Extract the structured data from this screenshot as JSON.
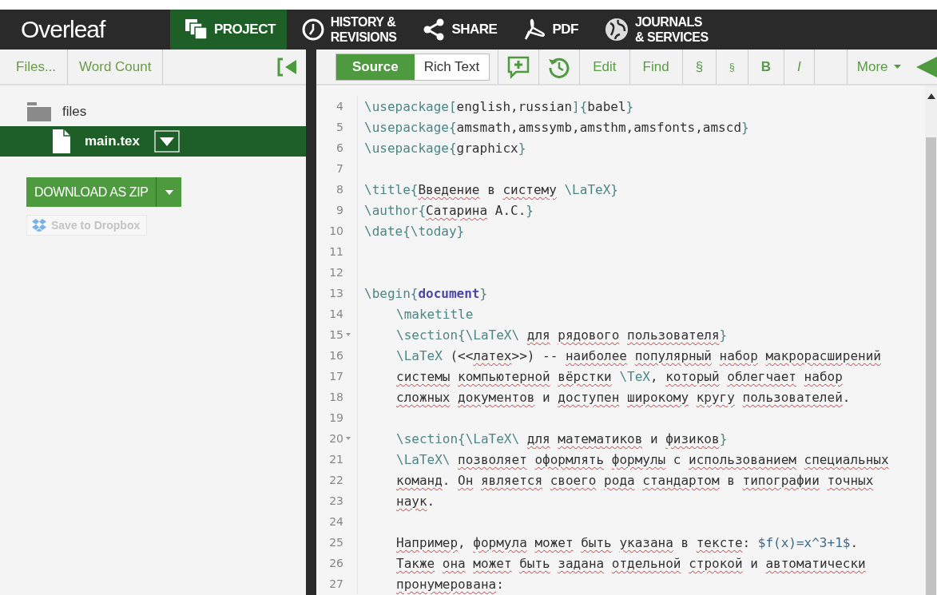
{
  "nav": {
    "logo": "Overleaf",
    "items": [
      {
        "kind": "project",
        "label": "PROJECT",
        "selected": true
      },
      {
        "kind": "history",
        "label": "HISTORY &",
        "label2": "REVISIONS",
        "selected": false
      },
      {
        "kind": "share",
        "label": "SHARE",
        "selected": false
      },
      {
        "kind": "pdf",
        "label": "PDF",
        "selected": false
      },
      {
        "kind": "journals",
        "label": "JOURNALS",
        "label2": "& SERVICES",
        "selected": false
      }
    ]
  },
  "sidebar": {
    "toolbar": [
      "Files...",
      "Word Count"
    ],
    "tree": [
      {
        "kind": "folder",
        "name": "files",
        "selected": false,
        "children": [
          {
            "kind": "file",
            "name": "main.tex",
            "selected": true
          }
        ]
      }
    ],
    "download_button": "DOWNLOAD AS ZIP",
    "dropbox_button": {
      "label": "Save to Dropbox",
      "disabled": true
    }
  },
  "editor_toolbar": {
    "modes": [
      {
        "label": "Source",
        "selected": true
      },
      {
        "label": "Rich Text",
        "selected": false
      }
    ],
    "tools": [
      {
        "kind": "comment"
      },
      {
        "kind": "history"
      },
      {
        "kind": "text",
        "label": "Edit"
      },
      {
        "kind": "text",
        "label": "Find"
      },
      {
        "kind": "text",
        "label": "§"
      },
      {
        "kind": "small",
        "label": "§"
      },
      {
        "kind": "bold",
        "label": "B"
      },
      {
        "kind": "italic",
        "label": "I"
      },
      {
        "kind": "blank"
      }
    ],
    "more": "More"
  },
  "code": [
    {
      "n": "4",
      "fold": false,
      "indented": false,
      "tokens": [
        {
          "kind": "cmd",
          "text": "\\usepackage["
        },
        {
          "kind": "text",
          "text": "english,russian"
        },
        {
          "kind": "cmd",
          "text": "]{"
        },
        {
          "kind": "text",
          "text": "babel"
        },
        {
          "kind": "cmd",
          "text": "}"
        }
      ]
    },
    {
      "n": "5",
      "fold": false,
      "indented": false,
      "tokens": [
        {
          "kind": "cmd",
          "text": "\\usepackage{"
        },
        {
          "kind": "text",
          "text": "amsmath,amssymb,amsthm,amsfonts,amscd"
        },
        {
          "kind": "cmd",
          "text": "}"
        }
      ]
    },
    {
      "n": "6",
      "fold": false,
      "indented": false,
      "tokens": [
        {
          "kind": "cmd",
          "text": "\\usepackage{"
        },
        {
          "kind": "text",
          "text": "graphicx"
        },
        {
          "kind": "cmd",
          "text": "}"
        }
      ]
    },
    {
      "n": "7"
    },
    {
      "n": "8",
      "fold": false,
      "indented": false,
      "tokens": [
        {
          "kind": "cmd",
          "text": "\\title{"
        },
        {
          "kind": "spell",
          "text": "Введение"
        },
        {
          "kind": "text",
          "text": " в "
        },
        {
          "kind": "spell",
          "text": "систему"
        },
        {
          "kind": "cmd",
          "text": " \\LaTeX}"
        }
      ]
    },
    {
      "n": "9",
      "fold": false,
      "indented": false,
      "tokens": [
        {
          "kind": "cmd",
          "text": "\\author{"
        },
        {
          "kind": "spell",
          "text": "Сатарина"
        },
        {
          "kind": "text",
          "text": " А.С."
        },
        {
          "kind": "cmd",
          "text": "}"
        }
      ]
    },
    {
      "n": "10",
      "fold": false,
      "indented": false,
      "tokens": [
        {
          "kind": "cmd",
          "text": "\\date{\\today}"
        }
      ]
    },
    {
      "n": "11"
    },
    {
      "n": "12"
    },
    {
      "n": "13",
      "fold": false,
      "indented": false,
      "tokens": [
        {
          "kind": "cmd",
          "text": "\\begin{"
        },
        {
          "kind": "env",
          "text": "document"
        },
        {
          "kind": "cmd",
          "text": "}"
        }
      ]
    },
    {
      "n": "14",
      "fold": false,
      "indented": true,
      "tokens": [
        {
          "kind": "cmd",
          "text": "\\maketitle"
        }
      ]
    },
    {
      "n": "15",
      "fold": true,
      "indented": true,
      "tokens": [
        {
          "kind": "cmd",
          "text": "\\section{\\LaTeX\\ "
        },
        {
          "kind": "spell",
          "text": "для рядового пользователя"
        },
        {
          "kind": "cmd",
          "text": "}"
        }
      ]
    },
    {
      "n": "16",
      "fold": false,
      "indented": true,
      "tokens": [
        {
          "kind": "cmd",
          "text": "\\LaTeX"
        },
        {
          "kind": "text",
          "text": " (<<"
        },
        {
          "kind": "spell",
          "text": "латех"
        },
        {
          "kind": "text",
          "text": ">>) -- "
        },
        {
          "kind": "spell",
          "text": "наиболее популярный набор макрорасширений"
        }
      ]
    },
    {
      "n": "17",
      "fold": false,
      "indented": true,
      "tokens": [
        {
          "kind": "spell",
          "text": "системы компьютерной вёрстки"
        },
        {
          "kind": "cmd",
          "text": " \\TeX"
        },
        {
          "kind": "text",
          "text": ", "
        },
        {
          "kind": "spell",
          "text": "который облегчает набор"
        }
      ]
    },
    {
      "n": "18",
      "fold": false,
      "indented": true,
      "tokens": [
        {
          "kind": "spell",
          "text": "сложных документов"
        },
        {
          "kind": "text",
          "text": " и "
        },
        {
          "kind": "spell",
          "text": "доступен широкому кругу пользователей"
        },
        {
          "kind": "text",
          "text": "."
        }
      ]
    },
    {
      "n": "19"
    },
    {
      "n": "20",
      "fold": true,
      "indented": true,
      "tokens": [
        {
          "kind": "cmd",
          "text": "\\section{\\LaTeX\\ "
        },
        {
          "kind": "spell",
          "text": "для математиков"
        },
        {
          "kind": "text",
          "text": " и "
        },
        {
          "kind": "spell",
          "text": "физиков"
        },
        {
          "kind": "cmd",
          "text": "}"
        }
      ]
    },
    {
      "n": "21",
      "fold": false,
      "indented": true,
      "tokens": [
        {
          "kind": "cmd",
          "text": "\\LaTeX\\ "
        },
        {
          "kind": "spell",
          "text": "позволяет оформлять формулы"
        },
        {
          "kind": "text",
          "text": " с "
        },
        {
          "kind": "spell",
          "text": "использованием специальных"
        }
      ]
    },
    {
      "n": "22",
      "fold": false,
      "indented": true,
      "tokens": [
        {
          "kind": "spell",
          "text": "команд"
        },
        {
          "kind": "text",
          "text": ". "
        },
        {
          "kind": "spell",
          "text": "Он является своего рода стандартом"
        },
        {
          "kind": "text",
          "text": " в "
        },
        {
          "kind": "spell",
          "text": "типографии точных"
        }
      ]
    },
    {
      "n": "23",
      "fold": false,
      "indented": true,
      "tokens": [
        {
          "kind": "spell",
          "text": "наук"
        },
        {
          "kind": "text",
          "text": "."
        }
      ]
    },
    {
      "n": "24"
    },
    {
      "n": "25",
      "fold": false,
      "indented": true,
      "tokens": [
        {
          "kind": "spell",
          "text": "Например"
        },
        {
          "kind": "text",
          "text": ", "
        },
        {
          "kind": "spell",
          "text": "формула может быть указана"
        },
        {
          "kind": "text",
          "text": " в "
        },
        {
          "kind": "spell",
          "text": "тексте"
        },
        {
          "kind": "text",
          "text": ": "
        },
        {
          "kind": "math",
          "text": "$f(x)=x^3+1$"
        },
        {
          "kind": "text",
          "text": "."
        }
      ]
    },
    {
      "n": "26",
      "fold": false,
      "indented": true,
      "tokens": [
        {
          "kind": "spell",
          "text": "Также она может быть задана отдельной строкой"
        },
        {
          "kind": "text",
          "text": " и "
        },
        {
          "kind": "spell",
          "text": "автоматически"
        }
      ]
    },
    {
      "n": "27",
      "fold": false,
      "indented": true,
      "tokens": [
        {
          "kind": "spell",
          "text": "пронумерована"
        },
        {
          "kind": "text",
          "text": ":"
        }
      ]
    }
  ]
}
